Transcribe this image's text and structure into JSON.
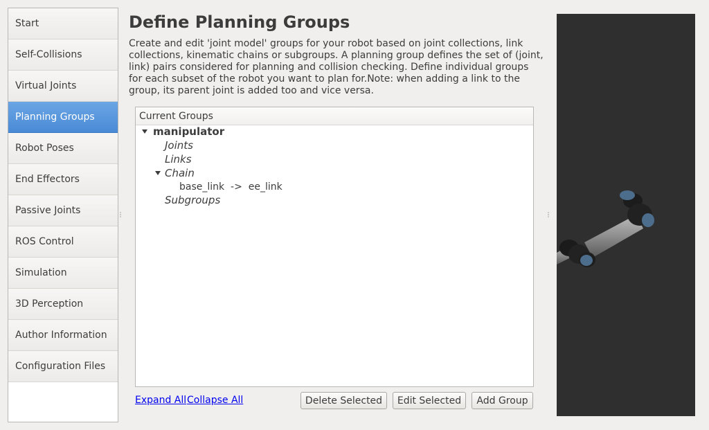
{
  "sidebar": {
    "items": [
      {
        "label": "Start"
      },
      {
        "label": "Self-Collisions"
      },
      {
        "label": "Virtual Joints"
      },
      {
        "label": "Planning Groups",
        "active": true
      },
      {
        "label": "Robot Poses"
      },
      {
        "label": "End Effectors"
      },
      {
        "label": "Passive Joints"
      },
      {
        "label": "ROS Control"
      },
      {
        "label": "Simulation"
      },
      {
        "label": "3D Perception"
      },
      {
        "label": "Author Information"
      },
      {
        "label": "Configuration Files"
      }
    ]
  },
  "main": {
    "title": "Define Planning Groups",
    "description": "Create and edit 'joint model' groups for your robot based on joint collections, link collections, kinematic chains or subgroups. A planning group defines the set of (joint, link) pairs considered for planning and collision checking. Define individual groups for each subset of the robot you want to plan for.Note: when adding a link to the group, its parent joint is added too and vice versa.",
    "tree": {
      "header": "Current Groups",
      "group_name": "manipulator",
      "joints_label": "Joints",
      "links_label": "Links",
      "chain_label": "Chain",
      "chain_entry": "base_link  ->  ee_link",
      "subgroups_label": "Subgroups"
    },
    "links": {
      "expand_all": "Expand All",
      "collapse_all": "Collapse All"
    },
    "buttons": {
      "delete_selected": "Delete Selected",
      "edit_selected": "Edit Selected",
      "add_group": "Add Group"
    }
  },
  "colors": {
    "active_nav": "#4a8ad6",
    "viewport_bg": "#2f2f2f",
    "link": "#0000ee"
  }
}
